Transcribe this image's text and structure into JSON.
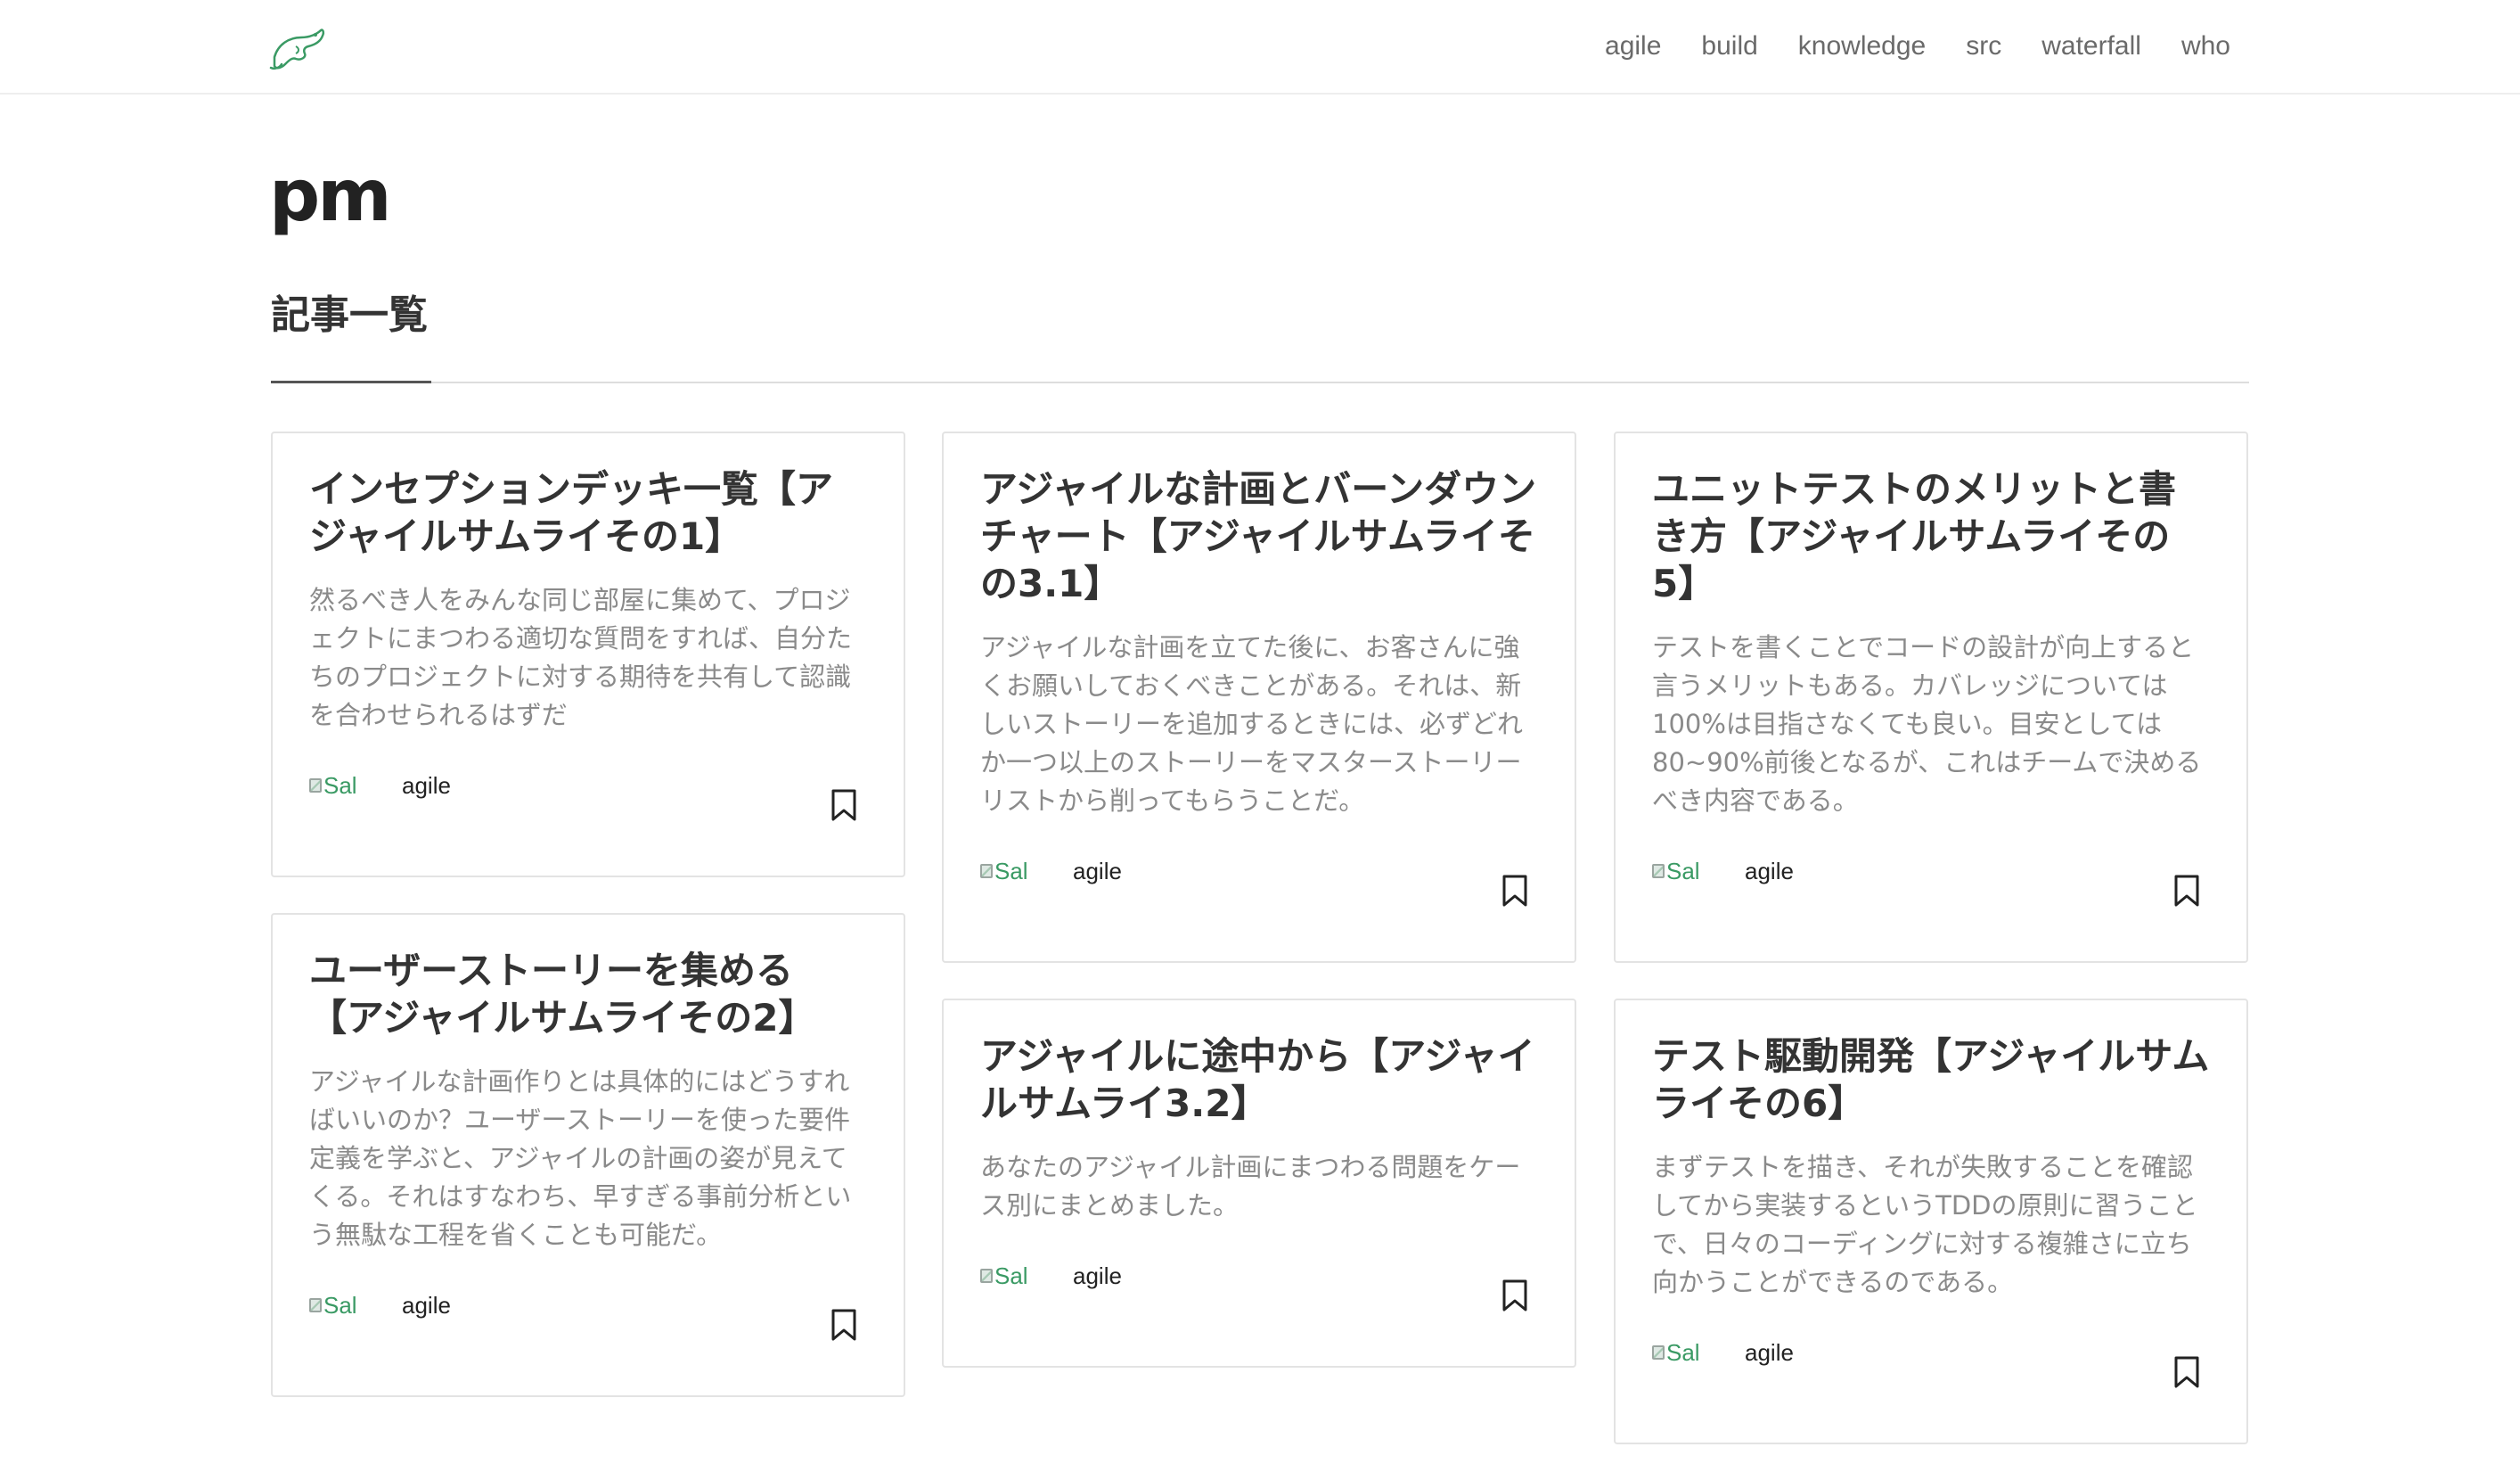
{
  "nav": {
    "items": [
      {
        "label": "agile"
      },
      {
        "label": "build"
      },
      {
        "label": "knowledge"
      },
      {
        "label": "src"
      },
      {
        "label": "waterfall"
      },
      {
        "label": "who"
      }
    ]
  },
  "page": {
    "title": "pm",
    "section_title": "記事一覧"
  },
  "articles": [
    {
      "title": "インセプションデッキ一覧【アジャイルサムライその1】",
      "excerpt": "然るべき人をみんな同じ部屋に集めて、プロジェクトにまつわる適切な質問をすれば、自分たちのプロジェクトに対する期待を共有して認識を合わせられるはずだ",
      "avatar_alt": "Sal",
      "author": "agile"
    },
    {
      "title": "ユーザーストーリーを集める【アジャイルサムライその2】",
      "excerpt": "アジャイルな計画作りとは具体的にはどうすればいいのか？ユーザーストーリーを使った要件定義を学ぶと、アジャイルの計画の姿が見えてくる。それはすなわち、早すぎる事前分析という無駄な工程を省くことも可能だ。",
      "avatar_alt": "Sal",
      "author": "agile"
    },
    {
      "title": "アジャイルな計画とバーンダウンチャート【アジャイルサムライその3.1】",
      "excerpt": "アジャイルな計画を立てた後に、お客さんに強くお願いしておくべきことがある。それは、新しいストーリーを追加するときには、必ずどれか一つ以上のストーリーをマスターストーリーリストから削ってもらうことだ。",
      "avatar_alt": "Sal",
      "author": "agile"
    },
    {
      "title": "アジャイルに途中から【アジャイルサムライ3.2】",
      "excerpt": "あなたのアジャイル計画にまつわる問題をケース別にまとめました。",
      "avatar_alt": "Sal",
      "author": "agile"
    },
    {
      "title": "ユニットテストのメリットと書き方【アジャイルサムライその5】",
      "excerpt": "テストを書くことでコードの設計が向上すると言うメリットもある。カバレッジについては100%は目指さなくても良い。目安としては80~90%前後となるが、これはチームで決めるべき内容である。",
      "avatar_alt": "Sal",
      "author": "agile"
    },
    {
      "title": "テスト駆動開発【アジャイルサムライその6】",
      "excerpt": "まずテストを描き、それが失敗することを確認してから実装するというTDDの原則に習うことで、日々のコーディングに対する複雑さに立ち向かうことができるのである。",
      "avatar_alt": "Sal",
      "author": "agile"
    }
  ]
}
